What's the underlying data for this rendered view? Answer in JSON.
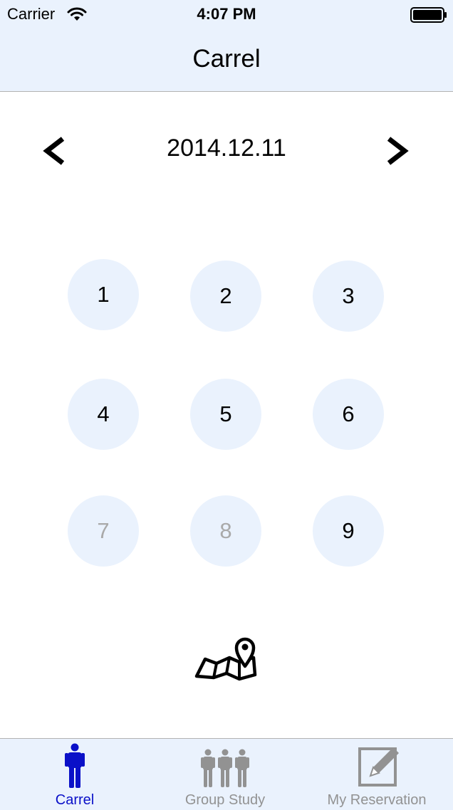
{
  "status_bar": {
    "carrier": "Carrier",
    "time": "4:07 PM",
    "wifi_icon": "wifi-icon",
    "battery_icon": "battery-icon"
  },
  "nav": {
    "title": "Carrel"
  },
  "date_picker": {
    "date": "2014.12.11",
    "prev_icon": "chevron-left-icon",
    "next_icon": "chevron-right-icon"
  },
  "seats": [
    {
      "label": "1",
      "available": true
    },
    {
      "label": "2",
      "available": true
    },
    {
      "label": "3",
      "available": true
    },
    {
      "label": "4",
      "available": true
    },
    {
      "label": "5",
      "available": true
    },
    {
      "label": "6",
      "available": true
    },
    {
      "label": "7",
      "available": false
    },
    {
      "label": "8",
      "available": false
    },
    {
      "label": "9",
      "available": true
    }
  ],
  "map_button": {
    "icon": "map-pin-icon"
  },
  "tabs": [
    {
      "label": "Carrel",
      "icon": "person-icon",
      "active": true
    },
    {
      "label": "Group Study",
      "icon": "group-icon",
      "active": false
    },
    {
      "label": "My Reservation",
      "icon": "edit-icon",
      "active": false
    }
  ],
  "colors": {
    "bar_background": "#eaf2fd",
    "active_tab": "#0a10c8",
    "inactive_tab": "#929292",
    "disabled_seat_text": "#a9a9a9"
  }
}
